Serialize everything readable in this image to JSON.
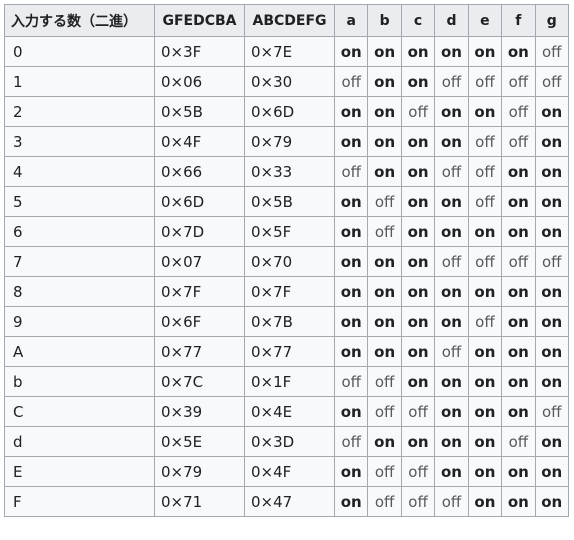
{
  "table": {
    "headers": [
      "入力する数（二進）",
      "GFEDCBA",
      "ABCDEFG",
      "a",
      "b",
      "c",
      "d",
      "e",
      "f",
      "g"
    ],
    "rows": [
      [
        "0",
        "0×3F",
        "0×7E",
        "on",
        "on",
        "on",
        "on",
        "on",
        "on",
        "off"
      ],
      [
        "1",
        "0×06",
        "0×30",
        "off",
        "on",
        "on",
        "off",
        "off",
        "off",
        "off"
      ],
      [
        "2",
        "0×5B",
        "0×6D",
        "on",
        "on",
        "off",
        "on",
        "on",
        "off",
        "on"
      ],
      [
        "3",
        "0×4F",
        "0×79",
        "on",
        "on",
        "on",
        "on",
        "off",
        "off",
        "on"
      ],
      [
        "4",
        "0×66",
        "0×33",
        "off",
        "on",
        "on",
        "off",
        "off",
        "on",
        "on"
      ],
      [
        "5",
        "0×6D",
        "0×5B",
        "on",
        "off",
        "on",
        "on",
        "off",
        "on",
        "on"
      ],
      [
        "6",
        "0×7D",
        "0×5F",
        "on",
        "off",
        "on",
        "on",
        "on",
        "on",
        "on"
      ],
      [
        "7",
        "0×07",
        "0×70",
        "on",
        "on",
        "on",
        "off",
        "off",
        "off",
        "off"
      ],
      [
        "8",
        "0×7F",
        "0×7F",
        "on",
        "on",
        "on",
        "on",
        "on",
        "on",
        "on"
      ],
      [
        "9",
        "0×6F",
        "0×7B",
        "on",
        "on",
        "on",
        "on",
        "off",
        "on",
        "on"
      ],
      [
        "A",
        "0×77",
        "0×77",
        "on",
        "on",
        "on",
        "off",
        "on",
        "on",
        "on"
      ],
      [
        "b",
        "0×7C",
        "0×1F",
        "off",
        "off",
        "on",
        "on",
        "on",
        "on",
        "on"
      ],
      [
        "C",
        "0×39",
        "0×4E",
        "on",
        "off",
        "off",
        "on",
        "on",
        "on",
        "off"
      ],
      [
        "d",
        "0×5E",
        "0×3D",
        "off",
        "on",
        "on",
        "on",
        "on",
        "off",
        "on"
      ],
      [
        "E",
        "0×79",
        "0×4F",
        "on",
        "off",
        "off",
        "on",
        "on",
        "on",
        "on"
      ],
      [
        "F",
        "0×71",
        "0×47",
        "on",
        "off",
        "off",
        "off",
        "on",
        "on",
        "on"
      ]
    ]
  }
}
